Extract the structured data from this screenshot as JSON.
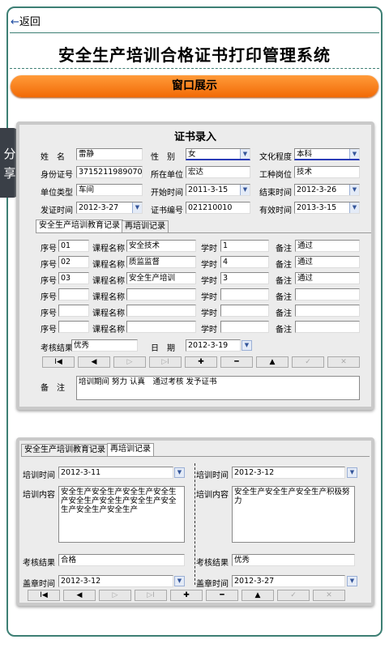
{
  "nav": {
    "back_arrow": "←",
    "back_label": "返回"
  },
  "page_title": "安全生产培训合格证书打印管理系统",
  "banner": "窗口展示",
  "share": [
    "分",
    "享"
  ],
  "cert": {
    "title": "证书录入",
    "labels": {
      "name": "姓　名",
      "gender": "性　别",
      "education": "文化程度",
      "id": "身份证号",
      "unit": "所在单位",
      "job": "工种岗位",
      "unit_type": "单位类型",
      "start": "开始时间",
      "end": "结束时间",
      "issue": "发证时间",
      "cert_no": "证书编号",
      "valid": "有效时间"
    },
    "values": {
      "name": "雷静",
      "gender": "女",
      "education": "本科",
      "id": "371521198907039899",
      "unit": "宏达",
      "job": "技术",
      "unit_type": "车间",
      "start": "2011-3-15",
      "end": "2012-3-26",
      "issue": "2012-3-27",
      "cert_no": "021210010",
      "valid": "2013-3-15"
    },
    "tabs": [
      "安全生产培训教育记录",
      "再培训记录"
    ],
    "row_labels": {
      "seq": "序号",
      "course": "课程名称",
      "hours": "学时",
      "note": "备注"
    },
    "rows": [
      {
        "seq": "01",
        "course": "安全技术",
        "hours": "1",
        "note": "通过"
      },
      {
        "seq": "02",
        "course": "质监监督",
        "hours": "4",
        "note": "通过"
      },
      {
        "seq": "03",
        "course": "安全生产培训",
        "hours": "3",
        "note": "通过"
      },
      {
        "seq": "",
        "course": "",
        "hours": "",
        "note": ""
      },
      {
        "seq": "",
        "course": "",
        "hours": "",
        "note": ""
      },
      {
        "seq": "",
        "course": "",
        "hours": "",
        "note": ""
      }
    ],
    "exam_label": "考核结果",
    "exam_value": "优秀",
    "date_label": "日　期",
    "date_value": "2012-3-19",
    "remark_label": "备　注",
    "remark_value": "培训期间 努力 认真　通过考核 发予证书"
  },
  "nav_buttons": [
    "I◀",
    "◀",
    "▷",
    "▷I",
    "✚",
    "━",
    "▲",
    "✓",
    "✕"
  ],
  "retrain": {
    "tabs": [
      "安全生产培训教育记录",
      "再培训记录"
    ],
    "left": {
      "time_label": "培训时间",
      "time_value": "2012-3-11",
      "content_label": "培训内容",
      "content_value": "安全生产安全生产安全生产安全生产安全生产安全生产安全生产安全生产安全生产安全生产",
      "exam_label": "考核结果",
      "exam_value": "合格",
      "stamp_label": "盖章时间",
      "stamp_value": "2012-3-12"
    },
    "right": {
      "time_label": "培训时间",
      "time_value": "2012-3-12",
      "content_label": "培训内容",
      "content_value": "安全生产安全生产安全生产积极努力",
      "exam_label": "考核结果",
      "exam_value": "优秀",
      "stamp_label": "盖章时间",
      "stamp_value": "2012-3-27"
    }
  }
}
